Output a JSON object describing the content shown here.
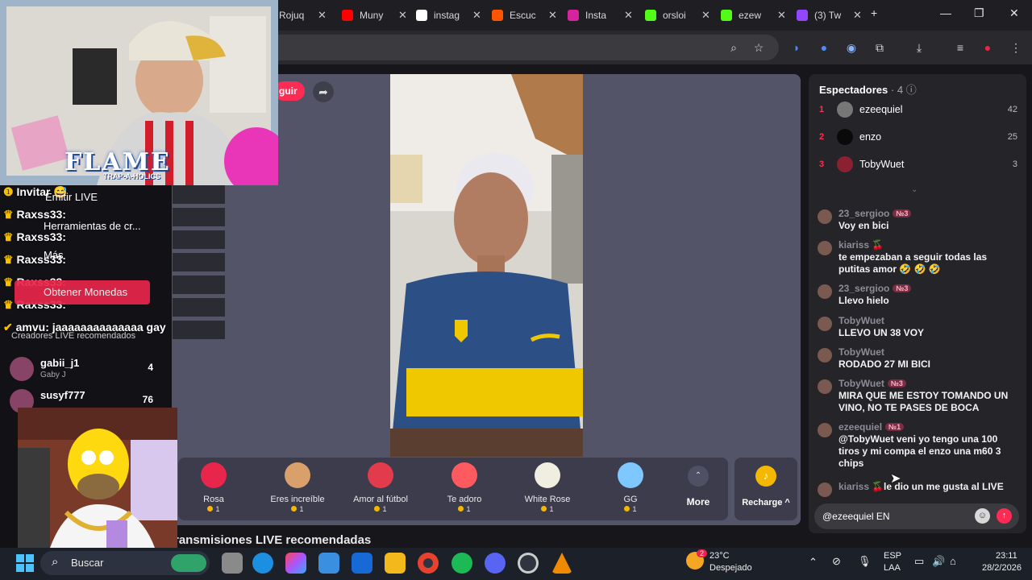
{
  "browser": {
    "tabs": [
      {
        "label": "Rojuq",
        "icon": "generic-tab-icon"
      },
      {
        "label": "Muny",
        "icon": "youtube-icon",
        "color": "#ff0000"
      },
      {
        "label": "instag",
        "icon": "google-icon"
      },
      {
        "label": "Escuc",
        "icon": "soundcloud-icon",
        "color": "#ff5500"
      },
      {
        "label": "Insta",
        "icon": "instagram-icon",
        "color": "#d6249f"
      },
      {
        "label": "orsloi",
        "icon": "kick-icon",
        "color": "#53fc18"
      },
      {
        "label": "ezew",
        "icon": "kick-icon",
        "color": "#53fc18"
      },
      {
        "label": "(3) Tw",
        "icon": "twitch-icon",
        "color": "#9146ff"
      }
    ],
    "new_tab": "+",
    "window": {
      "minimize": "—",
      "maximize": "❐",
      "close": "✕"
    }
  },
  "stream": {
    "follow_label": "guir",
    "gifts": [
      {
        "name": "Rosa",
        "price": "1",
        "icon": "rose-icon",
        "color": "#e8264b"
      },
      {
        "name": "Eres increíble",
        "price": "1",
        "icon": "cat-icon",
        "color": "#d9a06b"
      },
      {
        "name": "Amor al fútbol",
        "price": "1",
        "icon": "football-heart-icon",
        "color": "#e23b4c"
      },
      {
        "name": "Te adoro",
        "price": "1",
        "icon": "heart-icon",
        "color": "#ff5a5f"
      },
      {
        "name": "White Rose",
        "price": "1",
        "icon": "white-rose-icon",
        "color": "#f0eee0"
      },
      {
        "name": "GG",
        "price": "1",
        "icon": "gg-icon",
        "color": "#7fc8ff"
      }
    ],
    "more_label": "More",
    "recharge_label": "Recharge ^",
    "recommended_heading": "ransmisiones LIVE recomendadas"
  },
  "chat": {
    "viewers_title": "Espectadores",
    "viewers_count": "· 4",
    "top_viewers": [
      {
        "rank": "1",
        "name": "ezeequiel",
        "score": "42",
        "avatar": "#777777"
      },
      {
        "rank": "2",
        "name": "enzo",
        "score": "25",
        "avatar": "#0a0a0a"
      },
      {
        "rank": "3",
        "name": "TobyWuet",
        "score": "3",
        "avatar": "#8a2030"
      }
    ],
    "messages": [
      {
        "user": "23_sergioo",
        "badge": "№3",
        "text": "Voy en bici"
      },
      {
        "user": "kiariss 🍒",
        "badge": "",
        "text": "te empezaban a seguir todas las putitas amor 🤣 🤣 🤣"
      },
      {
        "user": "23_sergioo",
        "badge": "№3",
        "text": "Llevo hielo"
      },
      {
        "user": "TobyWuet",
        "badge": "",
        "text": "LLEVO UN 38 VOY"
      },
      {
        "user": "TobyWuet",
        "badge": "",
        "text": "RODADO 27 MI BICI"
      },
      {
        "user": "TobyWuet",
        "badge": "№3",
        "text": "MIRA QUE ME ESTOY TOMANDO UN VINO, NO TE PASES DE BOCA"
      },
      {
        "user": "ezeequiel",
        "badge": "№1",
        "text": "@TobyWuet veni yo tengo una 100 tiros y mi compa el enzo una m60 3 chips"
      },
      {
        "user": "kiariss 🍒",
        "badge": "",
        "text": "le dio un me gusta al LIVE"
      }
    ],
    "input_value": "@ezeequiel EN"
  },
  "overlay": {
    "lines": [
      "Invitar 😅",
      "Raxss33:",
      "Raxss33:",
      "Raxss33:",
      "Raxss33:",
      "Raxss33:",
      "amvu: jaaaaaaaaaaaaaa gay"
    ],
    "menu": [
      "Emitir LIVE",
      "Herramientas de cr...",
      "Más"
    ],
    "coins_label": "Obtener Monedas",
    "creators_heading": "Creadores LIVE recomendados",
    "creators": [
      {
        "name": "gabii_j1",
        "sub": "Gaby J",
        "count": "4"
      },
      {
        "name": "susyf777",
        "sub": "",
        "count": "76"
      }
    ],
    "banner_text": "FLAME",
    "banner_sub": "TRAP-A-HOLICS"
  },
  "taskbar": {
    "search_placeholder": "Buscar",
    "weather_temp": "23°C",
    "weather_desc": "Despejado",
    "weather_badge": "2",
    "lang": "ESP",
    "lang_sub": "LAA",
    "time": "23:11",
    "date": "28/2/2026"
  }
}
